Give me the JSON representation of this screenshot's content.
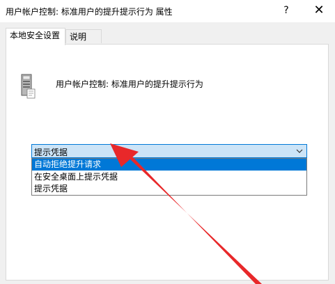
{
  "window": {
    "title": "用户帐户控制: 标准用户的提升提示行为 属性"
  },
  "titlebar": {
    "help_glyph": "?",
    "close_glyph": "✕"
  },
  "tabs": [
    {
      "label": "本地安全设置",
      "active": true
    },
    {
      "label": "说明",
      "active": false
    }
  ],
  "policy": {
    "title": "用户帐户控制: 标准用户的提升提示行为",
    "icon": "server-policy-icon"
  },
  "combo": {
    "value": "提示凭据"
  },
  "dropdown": {
    "options": [
      {
        "label": "自动拒绝提升请求",
        "selected": true
      },
      {
        "label": "在安全桌面上提示凭据",
        "selected": false
      },
      {
        "label": "提示凭据",
        "selected": false
      }
    ]
  },
  "colors": {
    "selection": "#0078d7",
    "combo_bg": "#cce4f7",
    "annotation_arrow": "#e8282a",
    "dialog_bg": "#f0f0f0"
  }
}
